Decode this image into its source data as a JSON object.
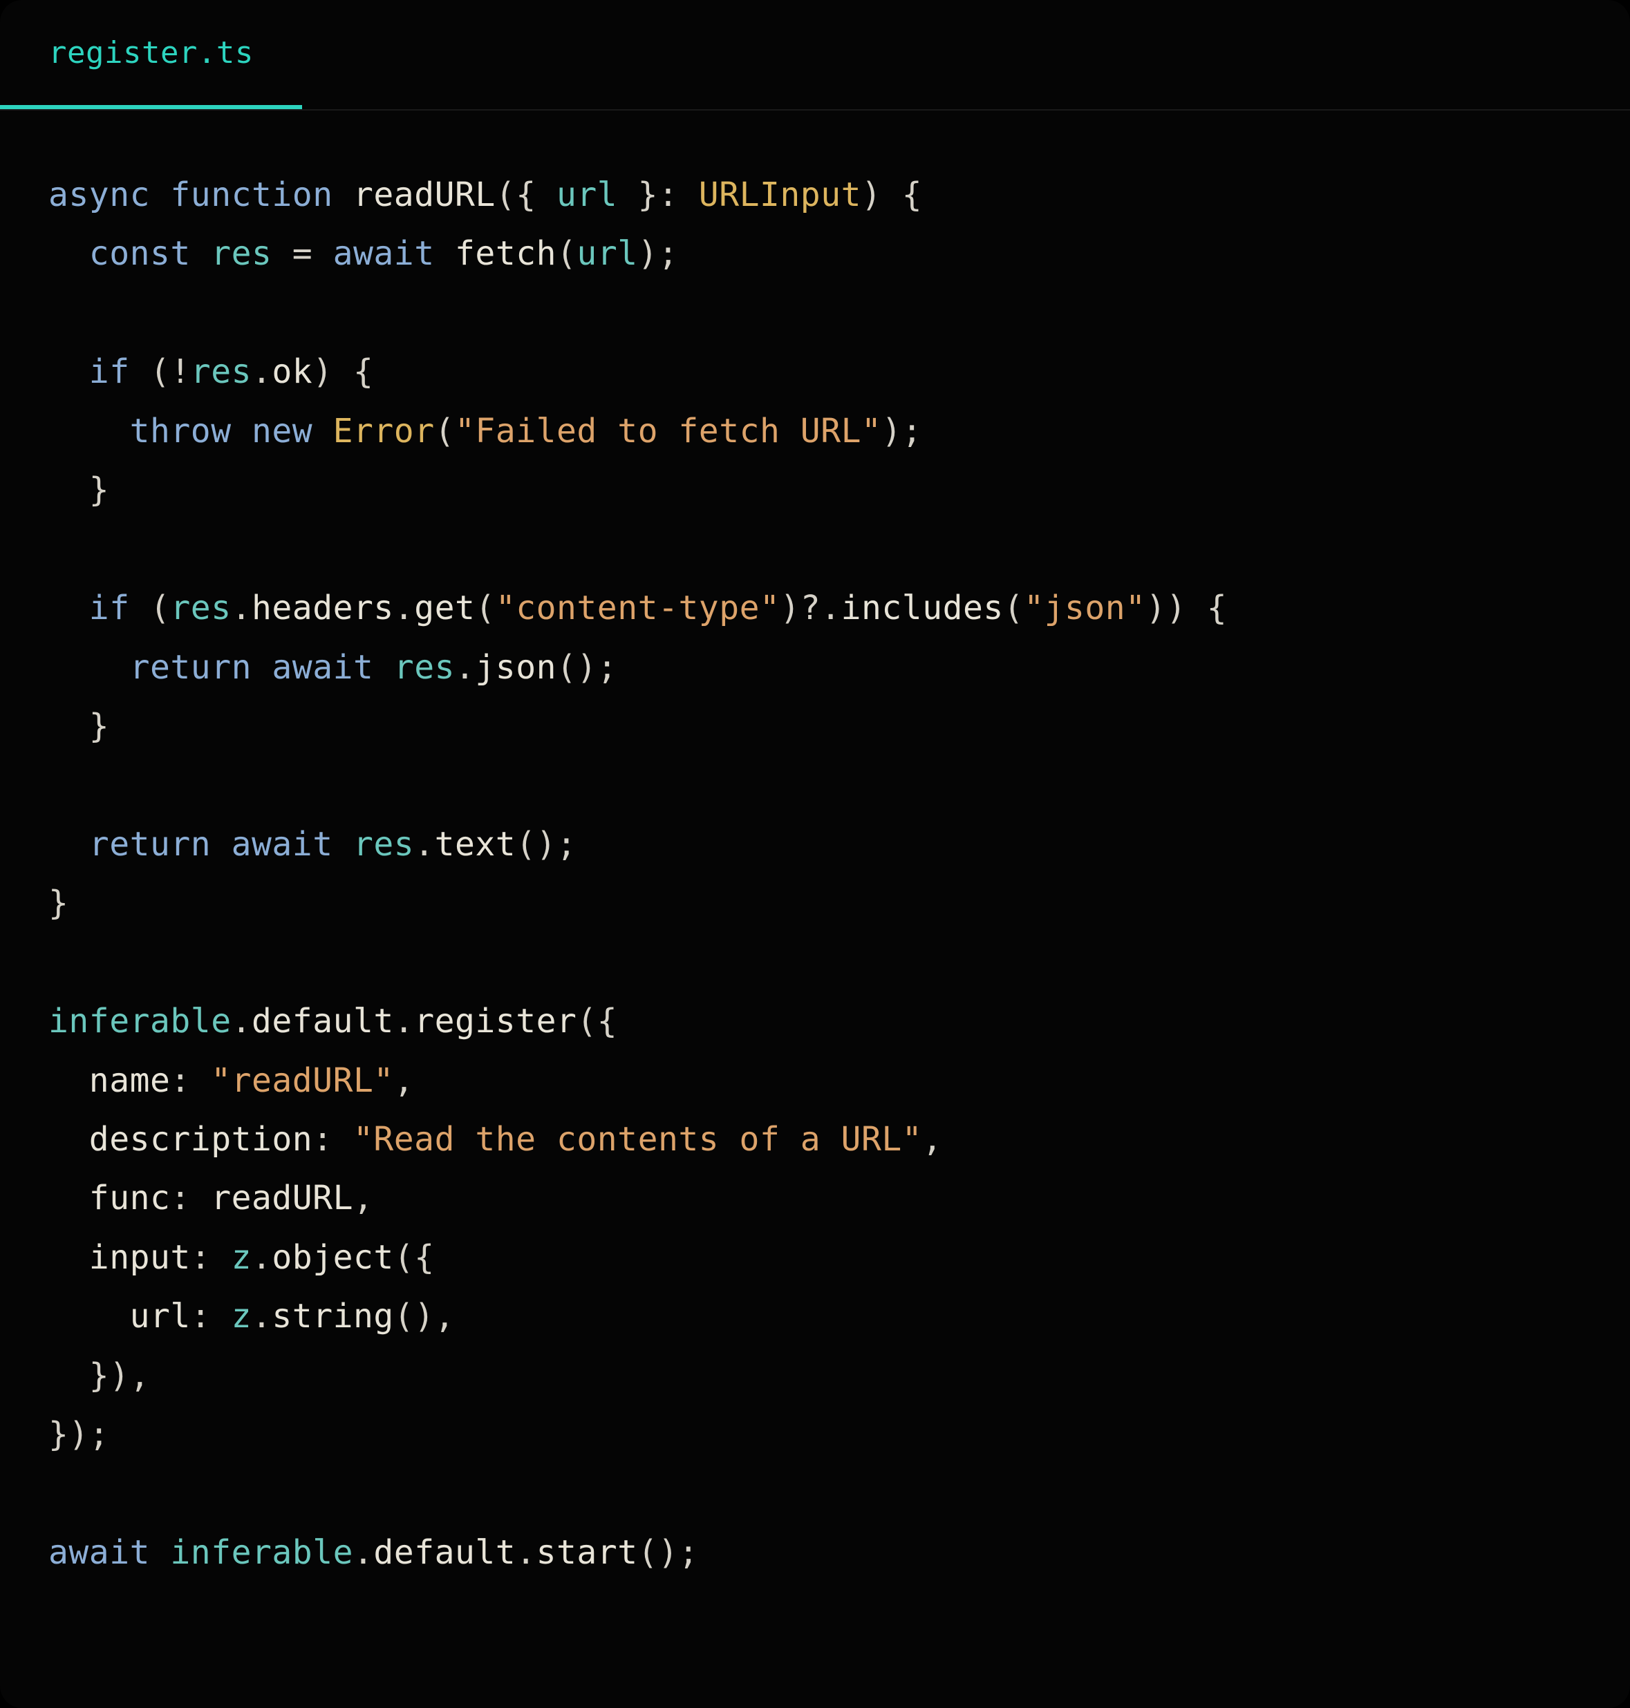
{
  "tab": {
    "filename": "register.ts"
  },
  "code": {
    "l1": {
      "kw1": "async",
      "kw2": "function",
      "fn": "readURL",
      "p1": "({ ",
      "id1": "url",
      "p2": " }: ",
      "type": "URLInput",
      "p3": ") {"
    },
    "l2": {
      "indent": "  ",
      "kw1": "const",
      "id1": "res",
      "op": " = ",
      "kw2": "await",
      "fn": "fetch",
      "p1": "(",
      "id2": "url",
      "p2": ");"
    },
    "l3": {
      "blank": " "
    },
    "l4": {
      "indent": "  ",
      "kw1": "if",
      "p1": " (!",
      "id1": "res",
      "dot": ".",
      "prop": "ok",
      "p2": ") {"
    },
    "l5": {
      "indent": "    ",
      "kw1": "throw",
      "kw2": "new",
      "type": "Error",
      "p1": "(",
      "str": "\"Failed to fetch URL\"",
      "p2": ");"
    },
    "l6": {
      "indent": "  ",
      "p1": "}"
    },
    "l7": {
      "blank": " "
    },
    "l8": {
      "indent": "  ",
      "kw1": "if",
      "p1": " (",
      "id1": "res",
      "dot1": ".",
      "prop1": "headers",
      "dot2": ".",
      "fn1": "get",
      "p2": "(",
      "str1": "\"content-type\"",
      "p3": ")?.",
      "fn2": "includes",
      "p4": "(",
      "str2": "\"json\"",
      "p5": ")) {"
    },
    "l9": {
      "indent": "    ",
      "kw1": "return",
      "kw2": "await",
      "id1": "res",
      "dot": ".",
      "fn": "json",
      "p1": "();"
    },
    "l10": {
      "indent": "  ",
      "p1": "}"
    },
    "l11": {
      "blank": " "
    },
    "l12": {
      "indent": "  ",
      "kw1": "return",
      "kw2": "await",
      "id1": "res",
      "dot": ".",
      "fn": "text",
      "p1": "();"
    },
    "l13": {
      "p1": "}"
    },
    "l14": {
      "blank": " "
    },
    "l15": {
      "id1": "inferable",
      "dot1": ".",
      "prop1": "default",
      "dot2": ".",
      "fn": "register",
      "p1": "({"
    },
    "l16": {
      "indent": "  ",
      "prop": "name",
      "p1": ": ",
      "str": "\"readURL\"",
      "p2": ","
    },
    "l17": {
      "indent": "  ",
      "prop": "description",
      "p1": ": ",
      "str": "\"Read the contents of a URL\"",
      "p2": ","
    },
    "l18": {
      "indent": "  ",
      "prop": "func",
      "p1": ": ",
      "id1": "readURL",
      "p2": ","
    },
    "l19": {
      "indent": "  ",
      "prop": "input",
      "p1": ": ",
      "id1": "z",
      "dot": ".",
      "fn": "object",
      "p2": "({"
    },
    "l20": {
      "indent": "    ",
      "prop": "url",
      "p1": ": ",
      "id1": "z",
      "dot": ".",
      "fn": "string",
      "p2": "(),"
    },
    "l21": {
      "indent": "  ",
      "p1": "}),"
    },
    "l22": {
      "p1": "});"
    },
    "l23": {
      "blank": " "
    },
    "l24": {
      "kw1": "await",
      "id1": "inferable",
      "dot1": ".",
      "prop1": "default",
      "dot2": ".",
      "fn": "start",
      "p1": "();"
    }
  }
}
